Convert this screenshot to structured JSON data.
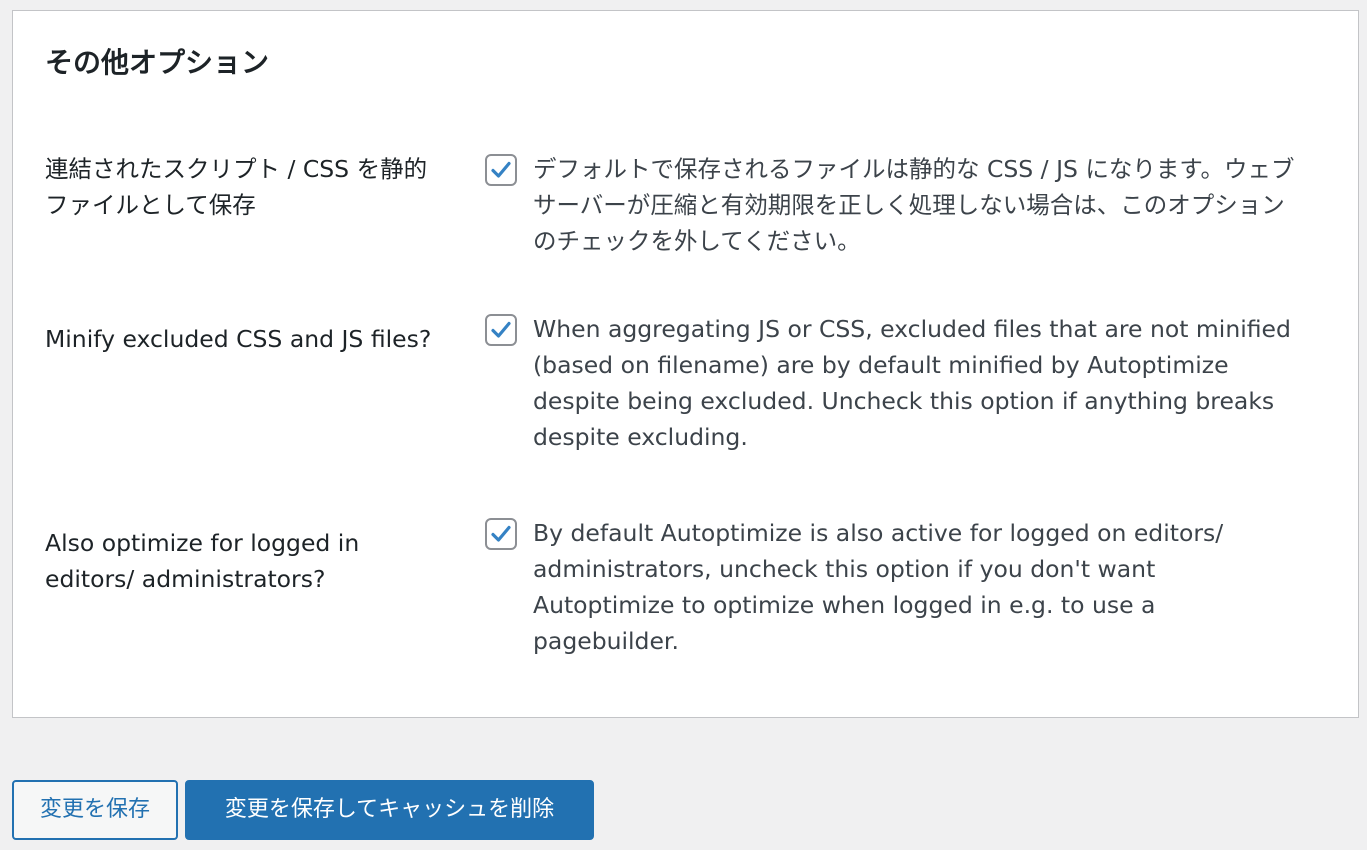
{
  "section": {
    "title": "その他オプション"
  },
  "options": [
    {
      "label": "連結されたスクリプト / CSS を静的ファイルとして保存",
      "checked": true,
      "description": "デフォルトで保存されるファイルは静的な CSS / JS になります。ウェブサーバーが圧縮と有効期限を正しく処理しない場合は、このオプションのチェックを外してください。"
    },
    {
      "label": "Minify excluded CSS and JS files?",
      "checked": true,
      "description": "When aggregating JS or CSS, excluded files that are not minified (based on filename) are by default minified by Autoptimize despite being excluded. Uncheck this option if anything breaks despite excluding."
    },
    {
      "label": "Also optimize for logged in editors/ administrators?",
      "checked": true,
      "description": "By default Autoptimize is also active for logged on editors/ administrators, uncheck this option if you don't want Autoptimize to optimize when logged in e.g. to use a pagebuilder."
    }
  ],
  "buttons": {
    "save_label": "変更を保存",
    "save_clear_label": "変更を保存してキャッシュを削除"
  },
  "colors": {
    "accent": "#2271b1",
    "checkmark": "#3582c4",
    "background": "#f0f0f1"
  }
}
